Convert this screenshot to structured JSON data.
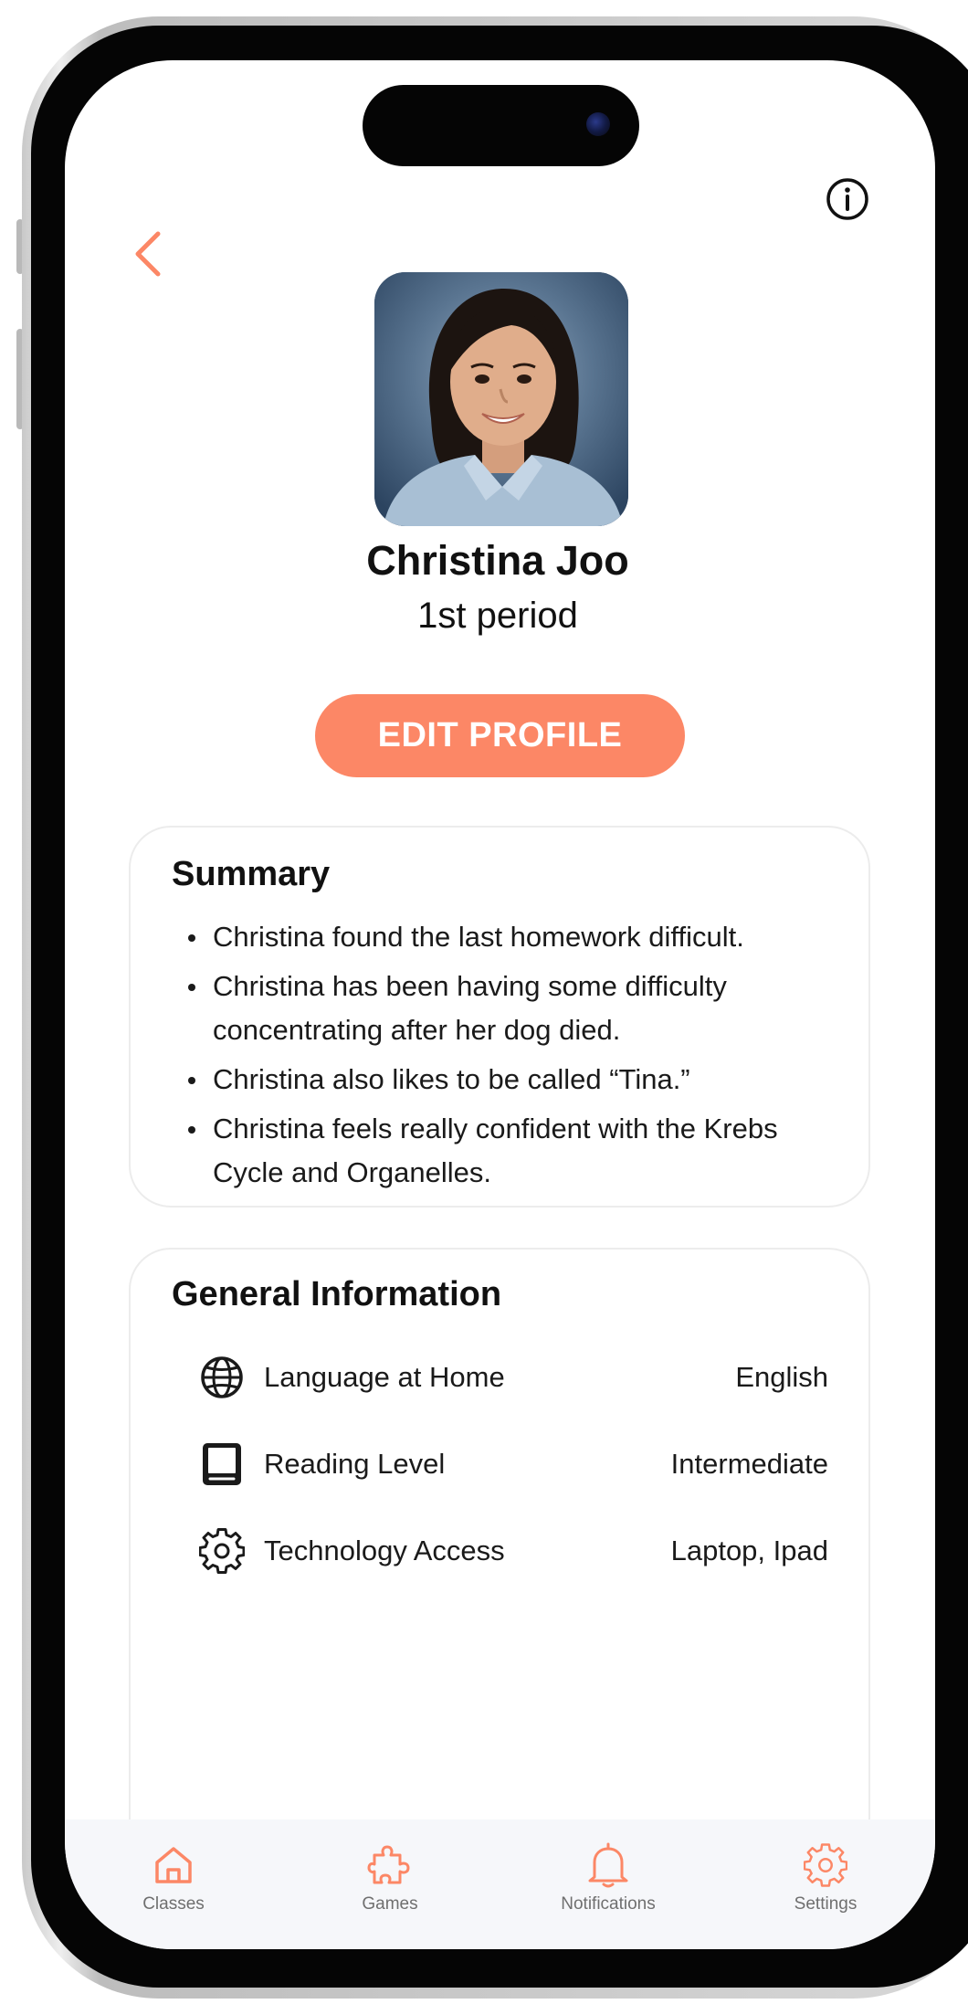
{
  "header": {
    "back_icon": "chevron-left-icon",
    "info_icon": "info-circle-icon"
  },
  "profile": {
    "name": "Christina Joo",
    "period": "1st period",
    "edit_label": "EDIT PROFILE"
  },
  "summary": {
    "title": "Summary",
    "items": [
      "Christina found the last homework difficult.",
      "Christina has been having some difficulty concentrating after her dog died.",
      "Christina also likes to be called “Tina.”",
      "Christina feels really confident with the Krebs Cycle and Organelles."
    ]
  },
  "general": {
    "title": "General Information",
    "rows": [
      {
        "icon": "globe-icon",
        "label": "Language at Home",
        "value": "English"
      },
      {
        "icon": "book-icon",
        "label": "Reading Level",
        "value": "Intermediate"
      },
      {
        "icon": "gear-icon",
        "label": "Technology Access",
        "value": "Laptop, Ipad"
      }
    ]
  },
  "tabs": [
    {
      "icon": "home-icon",
      "label": "Classes"
    },
    {
      "icon": "puzzle-icon",
      "label": "Games"
    },
    {
      "icon": "bell-icon",
      "label": "Notifications"
    },
    {
      "icon": "gear-icon",
      "label": "Settings"
    }
  ],
  "colors": {
    "accent": "#fc8766",
    "text": "#111111",
    "tab_label": "#6f6f6f"
  }
}
